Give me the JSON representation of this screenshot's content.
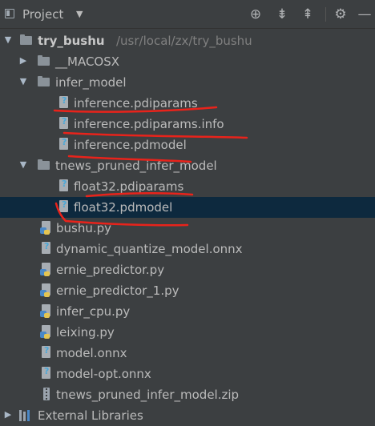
{
  "header": {
    "title": "Project",
    "icons": [
      "project-square-icon",
      "dropdown-caret-icon",
      "locate-target-icon",
      "expand-all-icon",
      "collapse-all-icon",
      "gear-icon",
      "hide-panel-icon"
    ]
  },
  "tree": {
    "root": {
      "name": "try_bushu",
      "path": "/usr/local/zx/try_bushu"
    },
    "macosx": "__MACOSX",
    "infer_model": {
      "name": "infer_model",
      "files": [
        "inference.pdiparams",
        "inference.pdiparams.info",
        "inference.pdmodel"
      ]
    },
    "tnews": {
      "name": "tnews_pruned_infer_model",
      "files": [
        "float32.pdiparams",
        "float32.pdmodel"
      ]
    },
    "root_files": [
      "bushu.py",
      "dynamic_quantize_model.onnx",
      "ernie_predictor.py",
      "ernie_predictor_1.py",
      "infer_cpu.py",
      "leixing.py",
      "model.onnx",
      "model-opt.onnx",
      "tnews_pruned_infer_model.zip"
    ],
    "external": "External Libraries"
  },
  "colors": {
    "background": "#3c3f41",
    "selection": "#0d293e",
    "annotation_red": "#e8231b",
    "path_gray": "#808080"
  }
}
